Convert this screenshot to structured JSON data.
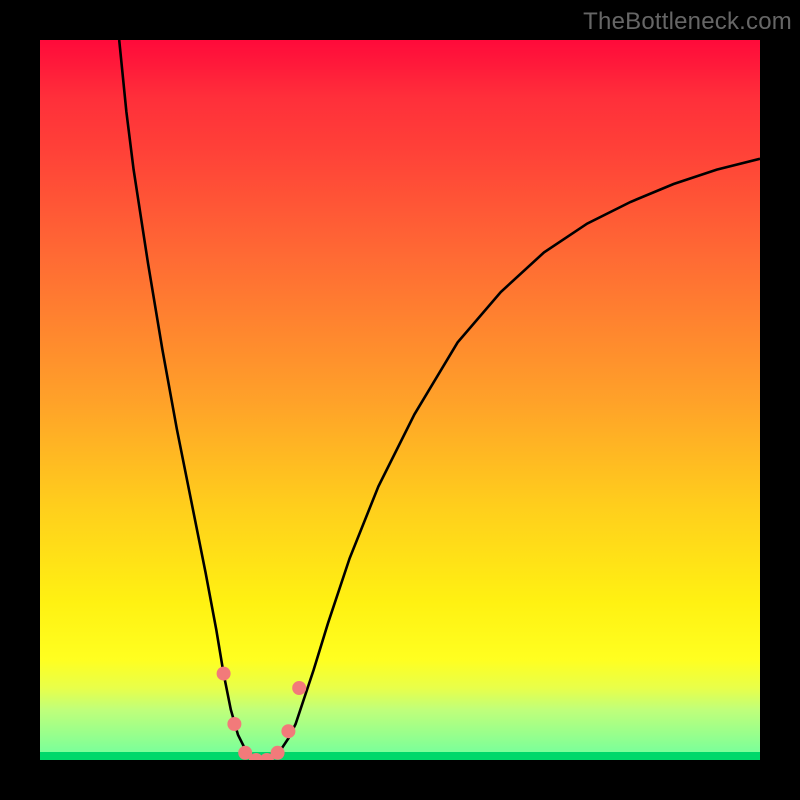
{
  "watermark": "TheBottleneck.com",
  "chart_data": {
    "type": "line",
    "title": "",
    "xlabel": "",
    "ylabel": "",
    "xlim": [
      0,
      100
    ],
    "ylim": [
      0,
      100
    ],
    "series": [
      {
        "name": "curve",
        "x": [
          11.0,
          12.0,
          13.0,
          15.0,
          17.0,
          19.0,
          21.0,
          23.0,
          24.5,
          25.5,
          26.5,
          27.5,
          28.5,
          29.5,
          30.5,
          31.5,
          32.5,
          33.5,
          34.5,
          35.5,
          36.5,
          38.0,
          40.0,
          43.0,
          47.0,
          52.0,
          58.0,
          64.0,
          70.0,
          76.0,
          82.0,
          88.0,
          94.0,
          100.0
        ],
        "values": [
          100.0,
          90.0,
          82.0,
          69.0,
          57.0,
          46.0,
          36.0,
          26.0,
          18.0,
          12.0,
          7.0,
          3.5,
          1.5,
          0.5,
          0.0,
          0.0,
          0.5,
          1.5,
          3.0,
          5.0,
          8.0,
          12.5,
          19.0,
          28.0,
          38.0,
          48.0,
          58.0,
          65.0,
          70.5,
          74.5,
          77.5,
          80.0,
          82.0,
          83.5
        ]
      }
    ],
    "markers": {
      "name": "dip-markers",
      "x": [
        25.5,
        27.0,
        28.5,
        30.0,
        31.5,
        33.0,
        34.5,
        36.0
      ],
      "values": [
        12.0,
        5.0,
        1.0,
        0.0,
        0.0,
        1.0,
        4.0,
        10.0
      ],
      "color": "#f27a7a",
      "radius": 7
    },
    "colors": {
      "curve_stroke": "#000000",
      "marker_fill": "#f27a7a",
      "bg_gradient_top": "#ff0a3a",
      "bg_gradient_bottom": "#00d86a"
    }
  }
}
